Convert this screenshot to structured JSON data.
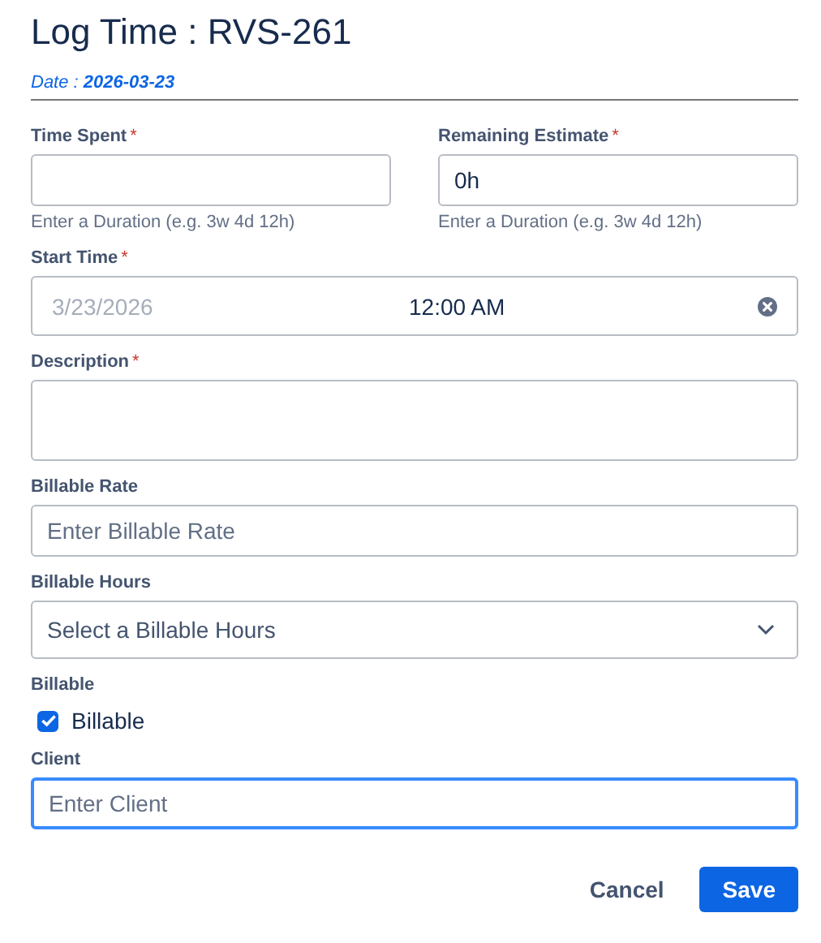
{
  "title": "Log Time : RVS-261",
  "date": {
    "label": "Date :",
    "value": "2026-03-23"
  },
  "rows": [
    {
      "fields": [
        {
          "kind": "text",
          "label": "Time Spent",
          "required_mark": "*",
          "help": "Enter a Duration (e.g. 3w 4d 12h)",
          "focused": false
        },
        {
          "kind": "text",
          "label": "Remaining Estimate",
          "required_mark": "*",
          "value": "0h",
          "help": "Enter a Duration (e.g. 3w 4d 12h)",
          "focused": false
        }
      ]
    },
    {
      "fields": [
        {
          "kind": "datetime",
          "label": "Start Time",
          "required_mark": "*",
          "date": "3/23/2026",
          "time": "12:00 AM"
        }
      ]
    },
    {
      "fields": [
        {
          "kind": "textarea",
          "label": "Description",
          "required_mark": "*",
          "focused": false
        }
      ]
    },
    {
      "fields": [
        {
          "kind": "text",
          "label": "Billable Rate",
          "placeholder": "Enter Billable Rate",
          "focused": false
        }
      ]
    },
    {
      "fields": [
        {
          "kind": "select",
          "label": "Billable Hours",
          "placeholder": "Select a Billable Hours"
        }
      ]
    },
    {
      "fields": [
        {
          "kind": "checkbox",
          "label": "Billable",
          "option": {
            "label": "Billable",
            "checked": true
          }
        }
      ]
    },
    {
      "fields": [
        {
          "kind": "text",
          "label": "Client",
          "placeholder": "Enter Client",
          "focused": true
        }
      ]
    }
  ],
  "buttons": [
    {
      "label": "Cancel",
      "kind": "secondary"
    },
    {
      "label": "Save",
      "kind": "primary"
    }
  ]
}
